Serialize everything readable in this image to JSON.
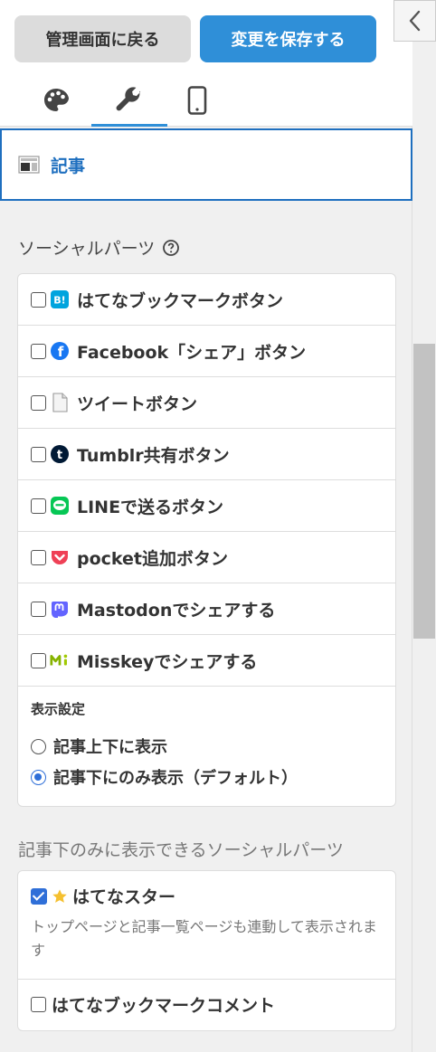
{
  "toolbar": {
    "back_label": "管理画面に戻る",
    "save_label": "変更を保存する"
  },
  "tabs": [
    {
      "name": "palette-icon",
      "active": false
    },
    {
      "name": "wrench-icon",
      "active": true
    },
    {
      "name": "smartphone-icon",
      "active": false
    }
  ],
  "section": {
    "title": "記事"
  },
  "social": {
    "heading": "ソーシャルパーツ",
    "items": [
      {
        "label": "はてなブックマークボタン",
        "icon": "hatena-bookmark-icon",
        "checked": false
      },
      {
        "label": "Facebook「シェア」ボタン",
        "icon": "facebook-icon",
        "checked": false
      },
      {
        "label": "ツイートボタン",
        "icon": "document-icon",
        "checked": false
      },
      {
        "label": "Tumblr共有ボタン",
        "icon": "tumblr-icon",
        "checked": false
      },
      {
        "label": "LINEで送るボタン",
        "icon": "line-icon",
        "checked": false
      },
      {
        "label": "pocket追加ボタン",
        "icon": "pocket-icon",
        "checked": false
      },
      {
        "label": "Mastodonでシェアする",
        "icon": "mastodon-icon",
        "checked": false
      },
      {
        "label": "Misskeyでシェアする",
        "icon": "misskey-icon",
        "checked": false
      }
    ],
    "display": {
      "heading": "表示設定",
      "options": [
        {
          "label": "記事上下に表示",
          "selected": false
        },
        {
          "label": "記事下にのみ表示（デフォルト）",
          "selected": true
        }
      ]
    }
  },
  "bottom": {
    "heading": "記事下のみに表示できるソーシャルパーツ",
    "star": {
      "label": "はてなスター",
      "checked": true,
      "note": "トップページと記事一覧ページも連動して表示されます"
    },
    "comment": {
      "label": "はてなブックマークコメント",
      "checked": false
    }
  },
  "colors": {
    "accent": "#2f8fd8",
    "section_border": "#1e6fbf"
  }
}
